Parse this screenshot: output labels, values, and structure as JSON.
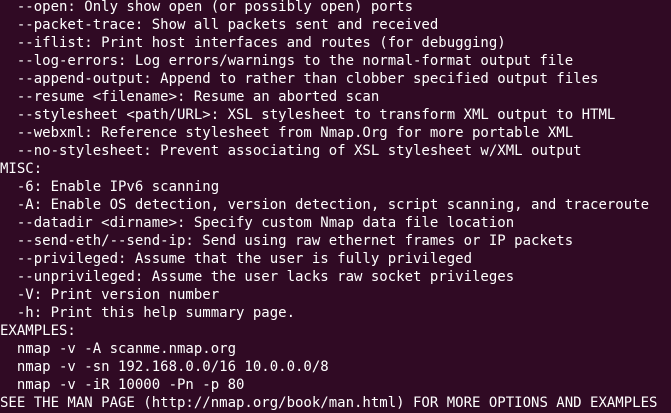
{
  "terminal": {
    "background": "#300a24",
    "foreground": "#ffffff",
    "lines": [
      "  --open: Only show open (or possibly open) ports",
      "  --packet-trace: Show all packets sent and received",
      "  --iflist: Print host interfaces and routes (for debugging)",
      "  --log-errors: Log errors/warnings to the normal-format output file",
      "  --append-output: Append to rather than clobber specified output files",
      "  --resume <filename>: Resume an aborted scan",
      "  --stylesheet <path/URL>: XSL stylesheet to transform XML output to HTML",
      "  --webxml: Reference stylesheet from Nmap.Org for more portable XML",
      "  --no-stylesheet: Prevent associating of XSL stylesheet w/XML output",
      "MISC:",
      "  -6: Enable IPv6 scanning",
      "  -A: Enable OS detection, version detection, script scanning, and traceroute",
      "  --datadir <dirname>: Specify custom Nmap data file location",
      "  --send-eth/--send-ip: Send using raw ethernet frames or IP packets",
      "  --privileged: Assume that the user is fully privileged",
      "  --unprivileged: Assume the user lacks raw socket privileges",
      "  -V: Print version number",
      "  -h: Print this help summary page.",
      "EXAMPLES:",
      "  nmap -v -A scanme.nmap.org",
      "  nmap -v -sn 192.168.0.0/16 10.0.0.0/8",
      "  nmap -v -iR 10000 -Pn -p 80",
      "SEE THE MAN PAGE (http://nmap.org/book/man.html) FOR MORE OPTIONS AND EXAMPLES"
    ]
  }
}
